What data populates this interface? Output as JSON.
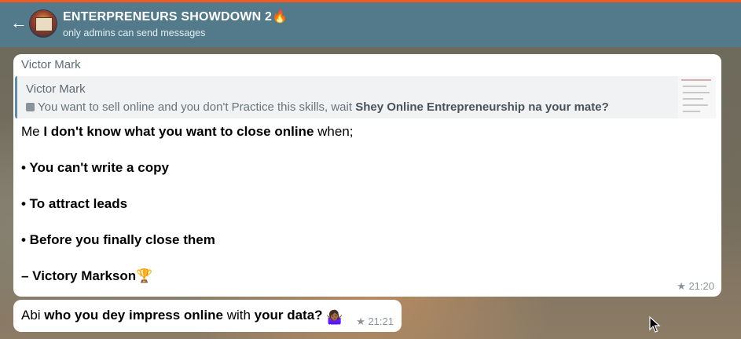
{
  "header": {
    "back_icon": "arrow-left-icon",
    "title": "ENTERPRENEURS SHOWDOWN 2🔥",
    "subtitle": "only admins can send messages"
  },
  "messages": [
    {
      "sender": "Victor Mark",
      "reply": {
        "name": "Victor Mark",
        "icon": "image-icon",
        "text_plain": "You want to sell online and you don't Practice this skills, wait ",
        "text_bold": "Shey Online Entrepreneurship na your mate?"
      },
      "lines": {
        "l1_a": "Me ",
        "l1_b": "I don't know what you want to close online",
        "l1_c": " when;",
        "l2": "• You can't write a copy",
        "l3": "• To attract leads",
        "l4": "• Before you finally close them",
        "l5": "– Victory Markson🏆"
      },
      "time": "★ 21:20"
    },
    {
      "a": "Abi ",
      "b": "who you dey impress online",
      "c": " with ",
      "d": "your data?",
      "emoji": "🤷🏾‍♀️",
      "time": "★ 21:21"
    }
  ],
  "colors": {
    "header": "#527a8a",
    "accent_line": "#f15a24",
    "bubble": "#ffffff"
  }
}
